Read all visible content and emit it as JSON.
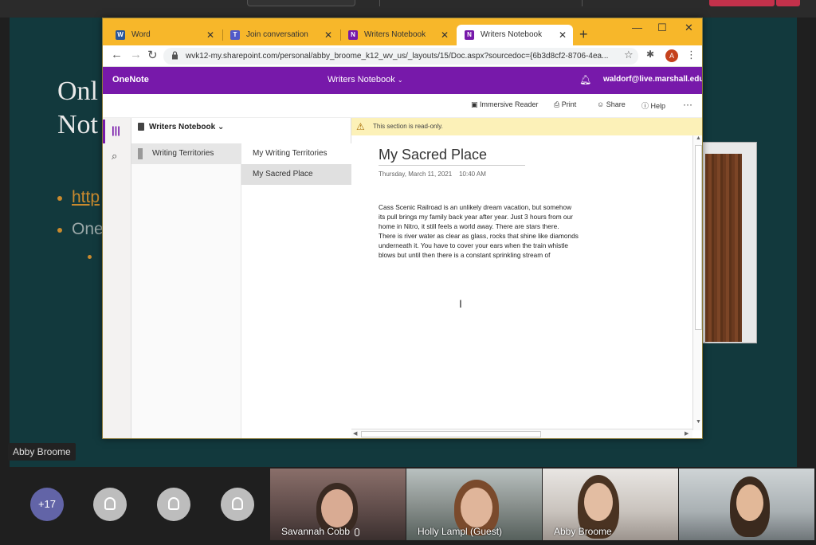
{
  "slide": {
    "title_line1": "Onl",
    "title_line2": "Not",
    "bullet1_link": "http",
    "bullet2": "One"
  },
  "presenter_tag": "Abby Broome",
  "browser": {
    "tabs": [
      {
        "label": "Word",
        "icon": "word-icon",
        "icon_color": "#2b579a",
        "icon_glyph": "W"
      },
      {
        "label": "Join conversation",
        "icon": "teams-icon",
        "icon_color": "#5059c9",
        "icon_glyph": "T"
      },
      {
        "label": "Writers Notebook",
        "icon": "onenote-icon",
        "icon_color": "#7719aa",
        "icon_glyph": "N"
      },
      {
        "label": "Writers Notebook",
        "icon": "onenote-icon",
        "icon_color": "#7719aa",
        "icon_glyph": "N"
      }
    ],
    "new_tab": "+",
    "url": "wvk12-my.sharepoint.com/personal/abby_broome_k12_wv_us/_layouts/15/Doc.aspx?sourcedoc={6b3d8cf2-8706-4ea...",
    "profile_initial": "A"
  },
  "onenote": {
    "brand": "OneNote",
    "notebook_name": "Writers Notebook",
    "account": "waldorf@live.marshall.edu",
    "ribbon": {
      "immersive_reader": "Immersive Reader",
      "print": "Print",
      "share": "Share",
      "help": "Help",
      "more": "···"
    },
    "notebook_title": "Writers Notebook",
    "sections": [
      "Writing Territories"
    ],
    "pages": [
      "My Writing Territories",
      "My Sacred Place"
    ],
    "readonly_notice": "This section is read-only.",
    "page": {
      "title": "My Sacred Place",
      "date": "Thursday, March 11, 2021",
      "time": "10:40 AM",
      "body_lines": [
        "Cass Scenic Railroad is an  unlikely dream vacation, but somehow",
        "its pull brings my family back year after year. Just 3 hours from our",
        "home in Nitro, it still feels a world away. There are stars there.",
        "There is river water as clear as glass, rocks that shine like diamonds",
        "underneath it. You have to cover your ears when the train whistle",
        "blows but until then there is a constant sprinkling stream of"
      ]
    }
  },
  "call": {
    "overflow_count": "+17",
    "participants": [
      {
        "name": "Savannah Cobb"
      },
      {
        "name": "Holly Lampl (Guest)"
      },
      {
        "name": "Abby Broome"
      },
      {
        "name": ""
      }
    ]
  },
  "colors": {
    "onenote_purple": "#7719aa",
    "chrome_tabstrip": "#f7b72a",
    "slide_background": "#12393d",
    "teams_accent": "#6264a7"
  }
}
